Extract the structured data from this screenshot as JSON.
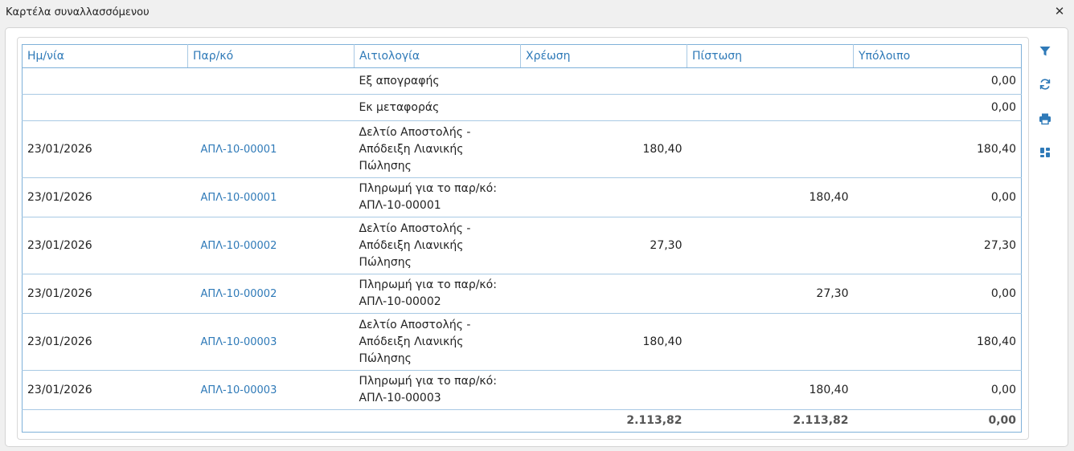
{
  "window": {
    "title": "Καρτέλα συναλλασσόμενου",
    "close_label": "✕"
  },
  "table": {
    "headers": [
      "Ημ/νία",
      "Παρ/κό",
      "Αιτιολογία",
      "Χρέωση",
      "Πίστωση",
      "Υπόλοιπο"
    ],
    "rows": [
      {
        "date": "",
        "doc": "",
        "reason": "Εξ απογραφής",
        "debit": "",
        "credit": "",
        "balance": "0,00"
      },
      {
        "date": "",
        "doc": "",
        "reason": "Εκ μεταφοράς",
        "debit": "",
        "credit": "",
        "balance": "0,00"
      },
      {
        "date": "23/01/2026",
        "doc": "ΑΠΛ-10-00001",
        "reason_lines": [
          "Δελτίο Αποστολής -",
          "Απόδειξη Λιανικής",
          "Πώλησης"
        ],
        "debit": "180,40",
        "credit": "",
        "balance": "180,40"
      },
      {
        "date": "23/01/2026",
        "doc": "ΑΠΛ-10-00001",
        "reason_lines": [
          "Πληρωμή για το παρ/κό:",
          "ΑΠΛ-10-00001"
        ],
        "debit": "",
        "credit": "180,40",
        "balance": "0,00"
      },
      {
        "date": "23/01/2026",
        "doc": "ΑΠΛ-10-00002",
        "reason_lines": [
          "Δελτίο Αποστολής -",
          "Απόδειξη Λιανικής",
          "Πώλησης"
        ],
        "debit": "27,30",
        "credit": "",
        "balance": "27,30"
      },
      {
        "date": "23/01/2026",
        "doc": "ΑΠΛ-10-00002",
        "reason_lines": [
          "Πληρωμή για το παρ/κό:",
          "ΑΠΛ-10-00002"
        ],
        "debit": "",
        "credit": "27,30",
        "balance": "0,00"
      },
      {
        "date": "23/01/2026",
        "doc": "ΑΠΛ-10-00003",
        "reason_lines": [
          "Δελτίο Αποστολής -",
          "Απόδειξη Λιανικής",
          "Πώλησης"
        ],
        "debit": "180,40",
        "credit": "",
        "balance": "180,40"
      },
      {
        "date": "23/01/2026",
        "doc": "ΑΠΛ-10-00003",
        "reason_lines": [
          "Πληρωμή για το παρ/κό:",
          "ΑΠΛ-10-00003"
        ],
        "debit": "",
        "credit": "180,40",
        "balance": "0,00"
      }
    ],
    "totals": {
      "debit": "2.113,82",
      "credit": "2.113,82",
      "balance": "0,00"
    }
  },
  "toolbar": {
    "icons": [
      "filter-icon",
      "refresh-icon",
      "print-icon",
      "layout-icon"
    ]
  },
  "colors": {
    "accent": "#2f7ab8",
    "grid": "#a8c9e4"
  }
}
